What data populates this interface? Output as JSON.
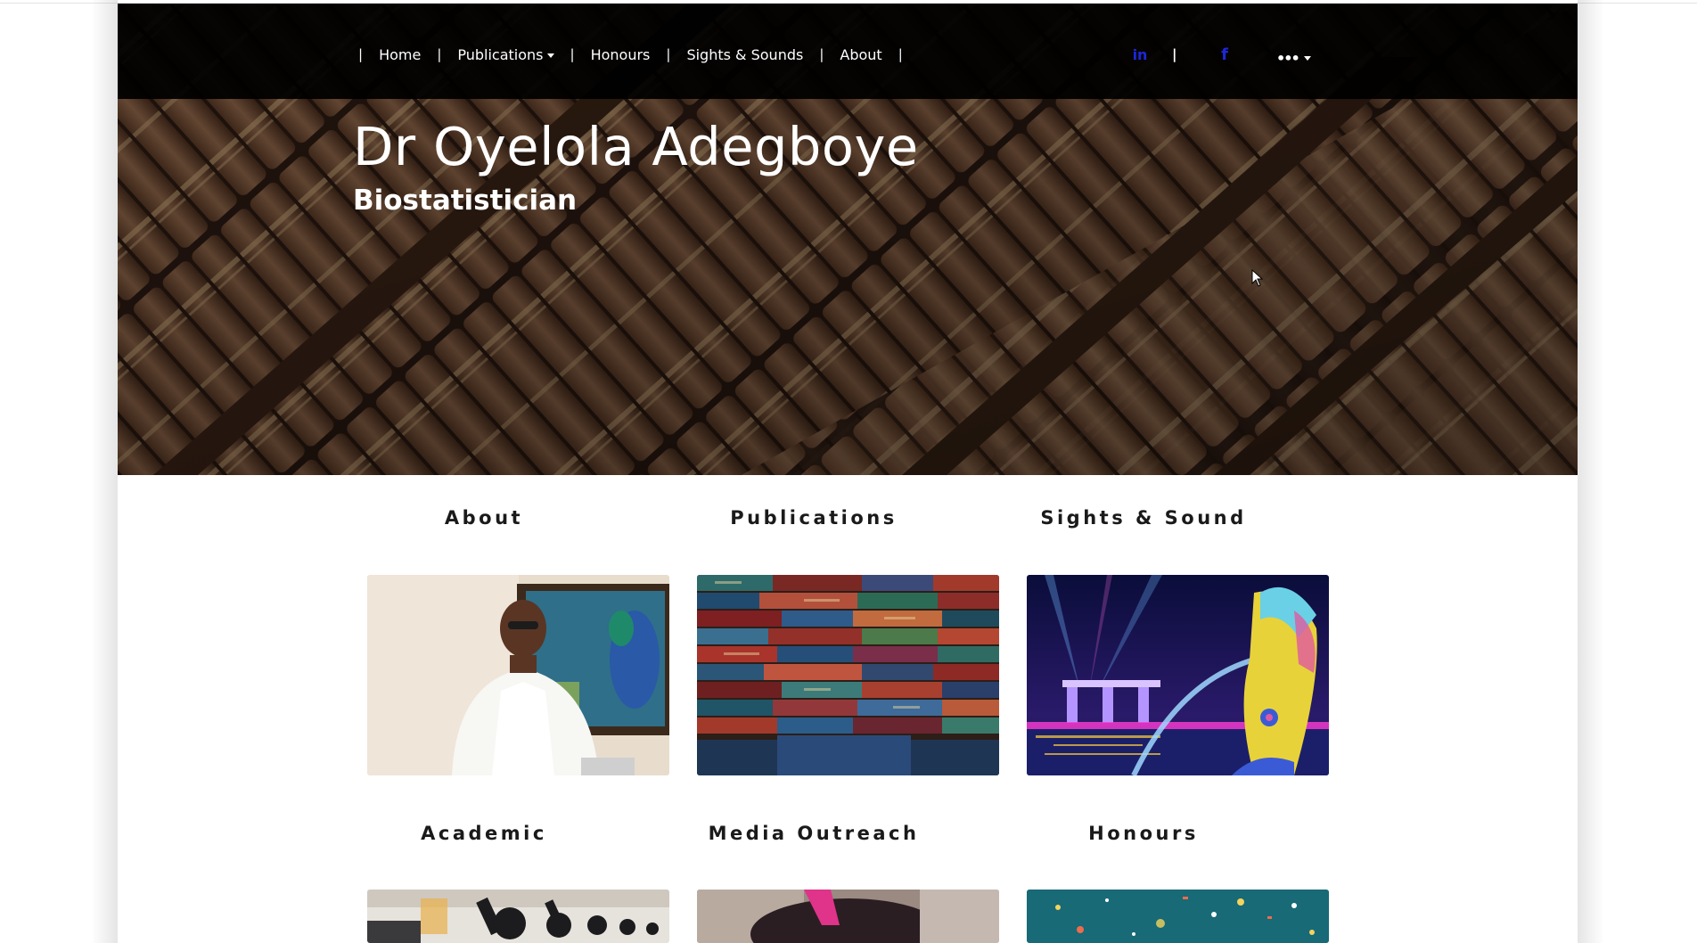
{
  "nav": {
    "items": [
      "Home",
      "Publications",
      "Honours",
      "Sights & Sounds",
      "About"
    ],
    "separator": "|",
    "linkedin_glyph": "in",
    "facebook_glyph": "f",
    "more_glyph": "•••"
  },
  "hero": {
    "title": "Dr Oyelola Adegboye",
    "subtitle": "Biostatistician"
  },
  "sections": [
    {
      "title": "About",
      "image_icon": "portrait-photo"
    },
    {
      "title": "Publications",
      "image_icon": "books-stack-photo"
    },
    {
      "title": "Sights & Sound",
      "image_icon": "merlion-night-photo"
    },
    {
      "title": "Academic",
      "image_icon": "microscopes-photo"
    },
    {
      "title": "Media Outreach",
      "image_icon": "media-photo"
    },
    {
      "title": "Honours",
      "image_icon": "confetti-photo"
    }
  ],
  "colors": {
    "navbar": "#000000",
    "social_icons": "#1d27d9",
    "section_title": "#1a1a1a"
  }
}
